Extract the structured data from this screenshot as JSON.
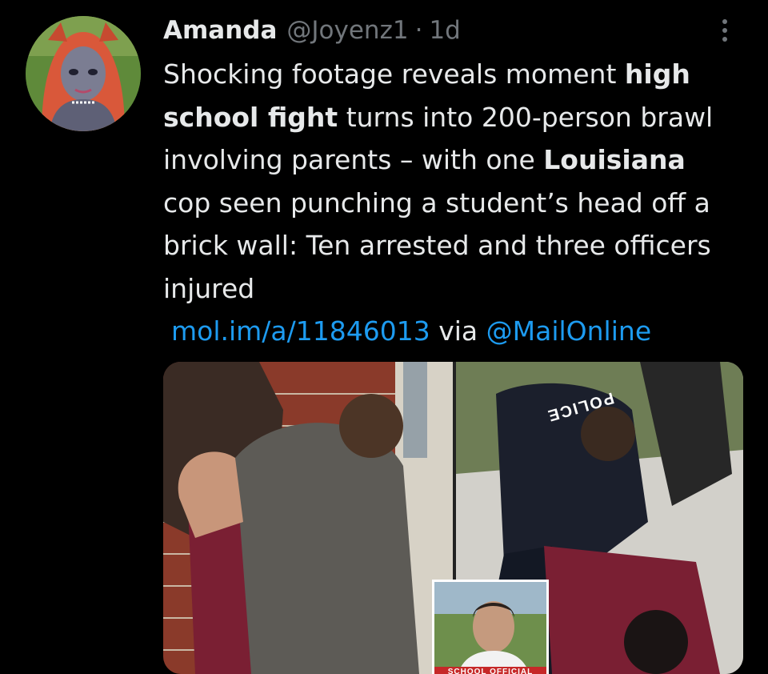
{
  "tweet": {
    "display_name": "Amanda",
    "handle": "@Joyenz1",
    "separator": "·",
    "time": "1d",
    "text": {
      "p1": "Shocking footage reveals moment ",
      "b1": "high school fight",
      "p2": " turns into 200-person brawl involving parents – with one ",
      "b2": "Louisiana",
      "p3": " cop seen punching a student’s head off a brick wall: Ten arrested and three officers injured",
      "link": "mol.im/a/11846013",
      "via": " via ",
      "mention": "@MailOnline"
    },
    "media": {
      "police_text": "POLICE",
      "inset_label": "SCHOOL OFFICIAL"
    }
  },
  "colors": {
    "background": "#000000",
    "text": "#e7e9ea",
    "muted": "#71767b",
    "link": "#1d9bf0"
  },
  "icons": {
    "more": "more-vertical-icon",
    "avatar": "avatar"
  }
}
